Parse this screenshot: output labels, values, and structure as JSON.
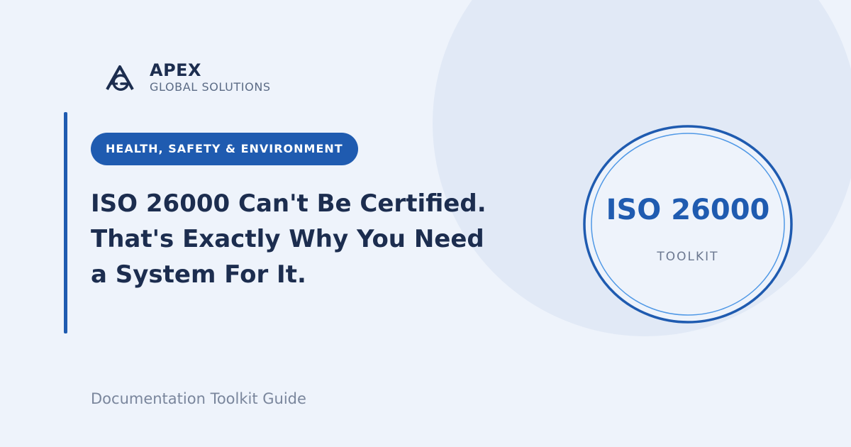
{
  "brand": {
    "name": "APEX",
    "subtitle": "GLOBAL SOLUTIONS",
    "logo_icon": "apex-ag-monogram-icon",
    "color": "#1c2d4f"
  },
  "category": {
    "label": "HEALTH, SAFETY & ENVIRONMENT",
    "color": "#1f5bb0"
  },
  "headline": {
    "line1": "ISO 26000 Can't Be Certified.",
    "line2": "That's Exactly Why You Need",
    "line3": "a System For It."
  },
  "badge": {
    "title": "ISO 26000",
    "label": "TOOLKIT",
    "ring_color": "#1f5bb0",
    "inner_ring_color": "#4f98e6"
  },
  "footer": {
    "subtitle": "Documentation Toolkit Guide"
  },
  "colors": {
    "background": "#eef3fb",
    "decor_circle": "#e1e9f6",
    "accent": "#1f5bb0"
  }
}
